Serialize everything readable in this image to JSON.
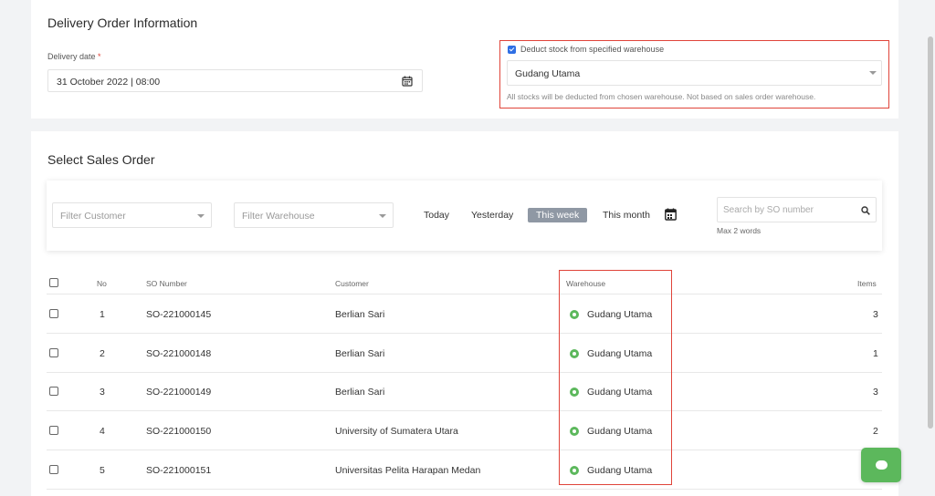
{
  "delivery_info": {
    "title": "Delivery Order Information",
    "date_label": "Delivery date",
    "required_mark": "*",
    "date_value": "31 October 2022 | 08:00",
    "deduct_label": "Deduct stock from specified warehouse",
    "deduct_checked": true,
    "warehouse_value": "Gudang Utama",
    "warehouse_note": "All stocks will be deducted from chosen warehouse. Not based on sales order warehouse."
  },
  "sales_order": {
    "title": "Select Sales Order",
    "filter_customer_placeholder": "Filter Customer",
    "filter_warehouse_placeholder": "Filter Warehouse",
    "periods": [
      "Today",
      "Yesterday",
      "This week",
      "This month"
    ],
    "active_period": "This week",
    "search_placeholder": "Search by SO number",
    "search_hint": "Max 2 words",
    "columns": [
      "No",
      "SO Number",
      "Customer",
      "Warehouse",
      "Items"
    ],
    "rows": [
      {
        "no": "1",
        "so": "SO-221000145",
        "customer": "Berlian Sari",
        "warehouse": "Gudang Utama",
        "items": "3"
      },
      {
        "no": "2",
        "so": "SO-221000148",
        "customer": "Berlian Sari",
        "warehouse": "Gudang Utama",
        "items": "1"
      },
      {
        "no": "3",
        "so": "SO-221000149",
        "customer": "Berlian Sari",
        "warehouse": "Gudang Utama",
        "items": "3"
      },
      {
        "no": "4",
        "so": "SO-221000150",
        "customer": "University of Sumatera Utara",
        "warehouse": "Gudang Utama",
        "items": "2"
      },
      {
        "no": "5",
        "so": "SO-221000151",
        "customer": "Universitas Pelita Harapan Medan",
        "warehouse": "Gudang Utama",
        "items": ""
      }
    ]
  },
  "colors": {
    "accent": "#2f6fe4",
    "highlight_border": "#e0443a",
    "pin": "#5cb85c",
    "active_period_bg": "#8f98a4"
  },
  "icons": [
    "calendar-icon",
    "chevron-down-icon",
    "search-icon",
    "location-pin-icon",
    "chat-icon"
  ]
}
